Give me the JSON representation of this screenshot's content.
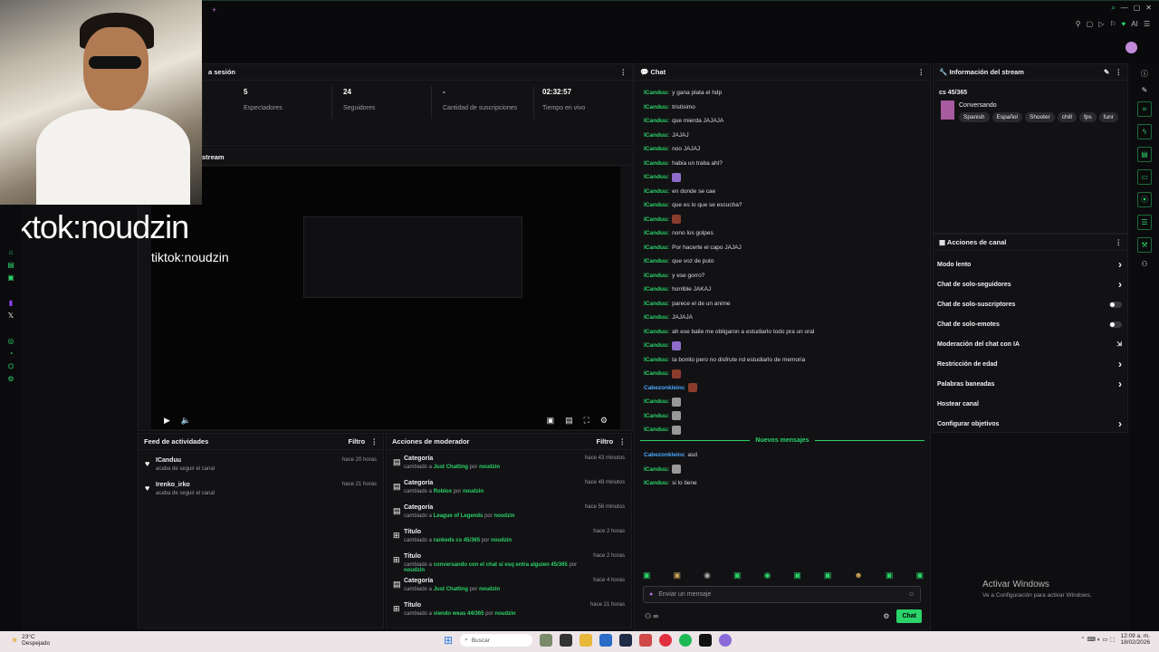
{
  "webcam": {
    "overlay_big": "tiktok:noudzin",
    "overlay_small": "tiktok:noudzin"
  },
  "session": {
    "title": "a sesión",
    "stats": [
      {
        "value": "5",
        "label": "Espectadores"
      },
      {
        "value": "24",
        "label": "Seguidores"
      },
      {
        "value": "-",
        "label": "Cantidad de suscripciones"
      },
      {
        "value": "02:32:57",
        "label": "Tiempo en vivo"
      }
    ]
  },
  "stream_panel": {
    "title": "stream"
  },
  "feed": {
    "title": "Feed de actividades",
    "filter": "Filtro",
    "items": [
      {
        "user": "ICanduu",
        "action": "acaba de seguir el canal",
        "time": "hace 20 horas"
      },
      {
        "user": "Irenko_irko",
        "action": "acaba de seguir el canal",
        "time": "hace 21 horas"
      }
    ]
  },
  "mod_actions": {
    "title": "Acciones de moderador",
    "filter": "Filtro",
    "by": "por",
    "items": [
      {
        "type": "Categoría",
        "prefix": "cambiado a",
        "value": "Just Chatting",
        "mod": "noudzin",
        "time": "hace 43 minutos"
      },
      {
        "type": "Categoría",
        "prefix": "cambiado a",
        "value": "Roblox",
        "mod": "noudzin",
        "time": "hace 49 minutos"
      },
      {
        "type": "Categoría",
        "prefix": "cambiado a",
        "value": "League of Legends",
        "mod": "noudzin",
        "time": "hace 56 minutos"
      },
      {
        "type": "Título",
        "prefix": "cambiado a",
        "value": "rankeds cs 45/365",
        "mod": "noudzin",
        "time": "hace 2 horas"
      },
      {
        "type": "Título",
        "prefix": "cambiado a",
        "value": "conversando con el chat si esq entra alguien 45/365",
        "mod": "noudzin",
        "time": "hace 2 horas"
      },
      {
        "type": "Categoría",
        "prefix": "cambiado a",
        "value": "Just Chatting",
        "mod": "noudzin",
        "time": "hace 4 horas"
      },
      {
        "type": "Título",
        "prefix": "cambiado a",
        "value": "viendo weas 44/365",
        "mod": "noudzin",
        "time": "hace 21 horas"
      }
    ]
  },
  "chat": {
    "title": "Chat",
    "messages": [
      {
        "user": "ICanduu:",
        "text": "y gana plata el hdp"
      },
      {
        "user": "ICanduu:",
        "text": "tristisimo"
      },
      {
        "user": "ICanduu:",
        "text": "que mierda JAJAJA"
      },
      {
        "user": "ICanduu:",
        "text": "JAJAJ"
      },
      {
        "user": "ICanduu:",
        "text": "noo JAJAJ"
      },
      {
        "user": "ICanduu:",
        "text": "habia un traba ahi?"
      },
      {
        "user": "ICanduu:",
        "text": "",
        "emote": "p"
      },
      {
        "user": "ICanduu:",
        "text": "en donde se cae"
      },
      {
        "user": "ICanduu:",
        "text": "que es lo que se escucha?"
      },
      {
        "user": "ICanduu:",
        "text": "",
        "emote": "r"
      },
      {
        "user": "ICanduu:",
        "text": "nono los golpes"
      },
      {
        "user": "ICanduu:",
        "text": "Por hacerte el capo JAJAJ"
      },
      {
        "user": "ICanduu:",
        "text": "que voz de puto"
      },
      {
        "user": "ICanduu:",
        "text": "y ese gorro?"
      },
      {
        "user": "ICanduu:",
        "text": "horrible JAKAJ"
      },
      {
        "user": "ICanduu:",
        "text": "parece el de un anime"
      },
      {
        "user": "ICanduu:",
        "text": "JAJAJA"
      },
      {
        "user": "ICanduu:",
        "text": "ah ese baile me obligaron a estudiarlo todo pra un oral"
      },
      {
        "user": "ICanduu:",
        "text": "",
        "emote": "p"
      },
      {
        "user": "ICanduu:",
        "text": "ta bonito pero no disfrute nd estudiarlo de memoria"
      },
      {
        "user": "ICanduu:",
        "text": "",
        "emote": "r"
      },
      {
        "user": "Cabezonkleinc",
        "text": "",
        "emote": "r",
        "blue": true
      },
      {
        "user": "ICanduu:",
        "text": "",
        "emote": "g"
      },
      {
        "user": "ICanduu:",
        "text": "",
        "emote": "g"
      },
      {
        "user": "ICanduu:",
        "text": "",
        "emote": "g"
      }
    ],
    "new_messages_label": "Nuevos mensajes",
    "new_messages": [
      {
        "user": "Cabezonkleinc",
        "text": "asd",
        "blue": true
      },
      {
        "user": "ICanduu:",
        "text": "",
        "emote": "g"
      },
      {
        "user": "ICanduu:",
        "text": "si lo tiene"
      }
    ],
    "input_placeholder": "Enviar un mensaje",
    "send_label": "Chat"
  },
  "stream_info": {
    "title": "Información del stream",
    "stream_title": "cs 45/365",
    "category": "Conversando",
    "tags": [
      "Spanish",
      "Español",
      "Shooter",
      "chill",
      "fps",
      "funr"
    ]
  },
  "channel_actions": {
    "title": "Acciones de canal",
    "items": [
      {
        "label": "Modo lento",
        "control": "arrow"
      },
      {
        "label": "Chat de solo-seguidores",
        "control": "arrow"
      },
      {
        "label": "Chat de solo-suscriptores",
        "control": "toggle"
      },
      {
        "label": "Chat de solo-emotes",
        "control": "toggle"
      },
      {
        "label": "Moderación del chat con IA",
        "control": "ext"
      },
      {
        "label": "Restricción de edad",
        "control": "arrow"
      },
      {
        "label": "Palabras baneadas",
        "control": "arrow"
      },
      {
        "label": "Hostear canal",
        "control": "none"
      },
      {
        "label": "Configurar objetivos",
        "control": "arrow"
      }
    ]
  },
  "windows_watermark": {
    "line1": "Activar Windows",
    "line2": "Ve a Configuración para activar Windows."
  },
  "taskbar": {
    "weather_temp": "23°C",
    "weather_desc": "Despejado",
    "search_label": "Buscar",
    "time": "12:09 a. m.",
    "date": "18/02/2026"
  },
  "topbar": {
    "ai_label": "AI"
  }
}
